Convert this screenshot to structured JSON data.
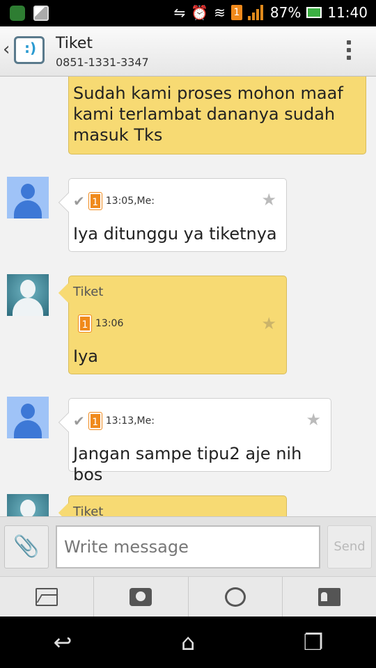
{
  "status_bar": {
    "battery_percent": "87%",
    "time": "11:40",
    "sim_label": "1"
  },
  "header": {
    "contact_name": "Tiket",
    "contact_number": "0851-1331-3347"
  },
  "messages": [
    {
      "direction": "incoming",
      "text_lines": [
        "Sudah kami proses mohon maaf",
        "kami terlambat dananya sudah",
        "masuk Tks"
      ]
    },
    {
      "direction": "outgoing",
      "meta": "13:05,Me:",
      "sim": "1",
      "text": "Iya ditunggu ya tiketnya"
    },
    {
      "direction": "incoming",
      "sender": "Tiket",
      "meta": "13:06",
      "sim": "1",
      "text": "Iya"
    },
    {
      "direction": "outgoing",
      "meta": "13:13,Me:",
      "sim": "1",
      "text": "Jangan sampe tipu2 aje nih bos"
    },
    {
      "direction": "incoming",
      "sender": "Tiket"
    }
  ],
  "compose": {
    "placeholder": "Write message",
    "send_label": "Send"
  },
  "colors": {
    "incoming_bubble": "#f7da73",
    "outgoing_bubble": "#ffffff",
    "sim_badge": "#f08a1c"
  }
}
